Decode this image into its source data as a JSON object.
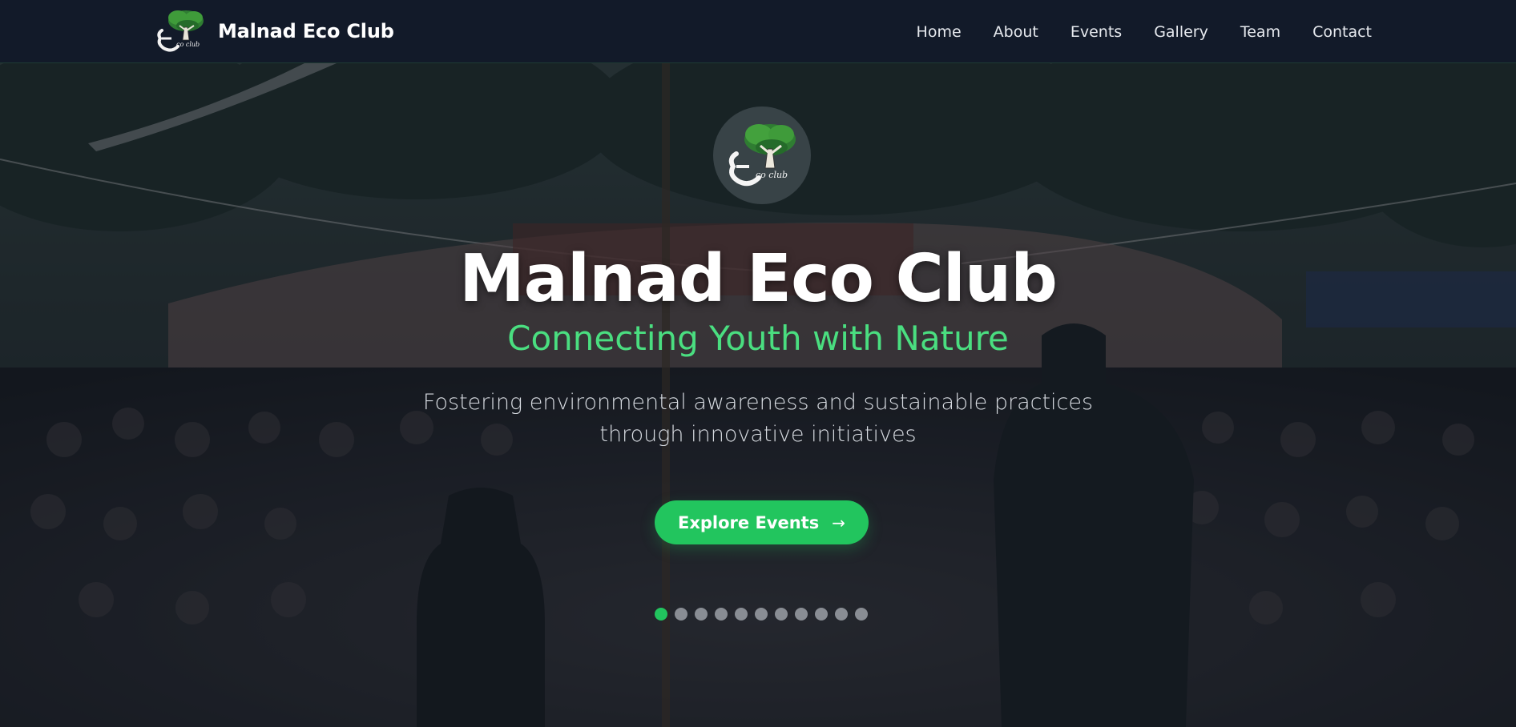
{
  "brand": {
    "name": "Malnad Eco Club",
    "logo_icon": "eco-club-tree-logo"
  },
  "nav": {
    "items": [
      {
        "label": "Home"
      },
      {
        "label": "About"
      },
      {
        "label": "Events"
      },
      {
        "label": "Gallery"
      },
      {
        "label": "Team"
      },
      {
        "label": "Contact"
      }
    ]
  },
  "hero": {
    "emblem_icon": "eco-club-tree-logo",
    "title": "Malnad Eco Club",
    "tagline": "Connecting Youth with Nature",
    "description": "Fostering environmental awareness and sustainable practices through innovative initiatives",
    "cta_label": "Explore Events",
    "cta_icon": "arrow-right-icon",
    "slides": {
      "total": 11,
      "active_index": 0
    }
  },
  "colors": {
    "accent": "#22c55e",
    "tagline": "#4ade80",
    "nav_bg": "#121a29"
  }
}
